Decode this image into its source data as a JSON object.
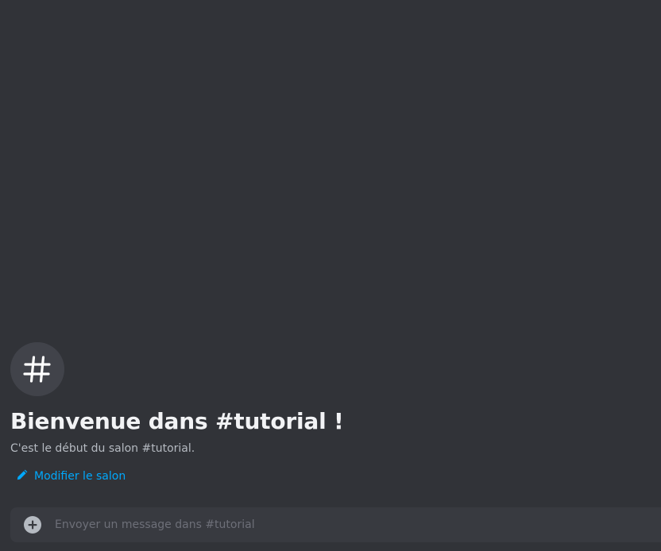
{
  "welcome": {
    "icon": "hashtag-icon",
    "title": "Bienvenue dans #tutorial !",
    "subtitle": "C'est le début du salon #tutorial.",
    "edit_icon": "pencil-icon",
    "edit_label": "Modifier le salon"
  },
  "composer": {
    "add_icon": "plus-circle-icon",
    "placeholder": "Envoyer un message dans #tutorial",
    "value": ""
  },
  "colors": {
    "background": "#313338",
    "icon_circle": "#41434a",
    "composer_bg": "#383a40",
    "title": "#f2f3f5",
    "subtitle": "#b5bac1",
    "link": "#00a8fc",
    "placeholder": "#6d6f78"
  }
}
